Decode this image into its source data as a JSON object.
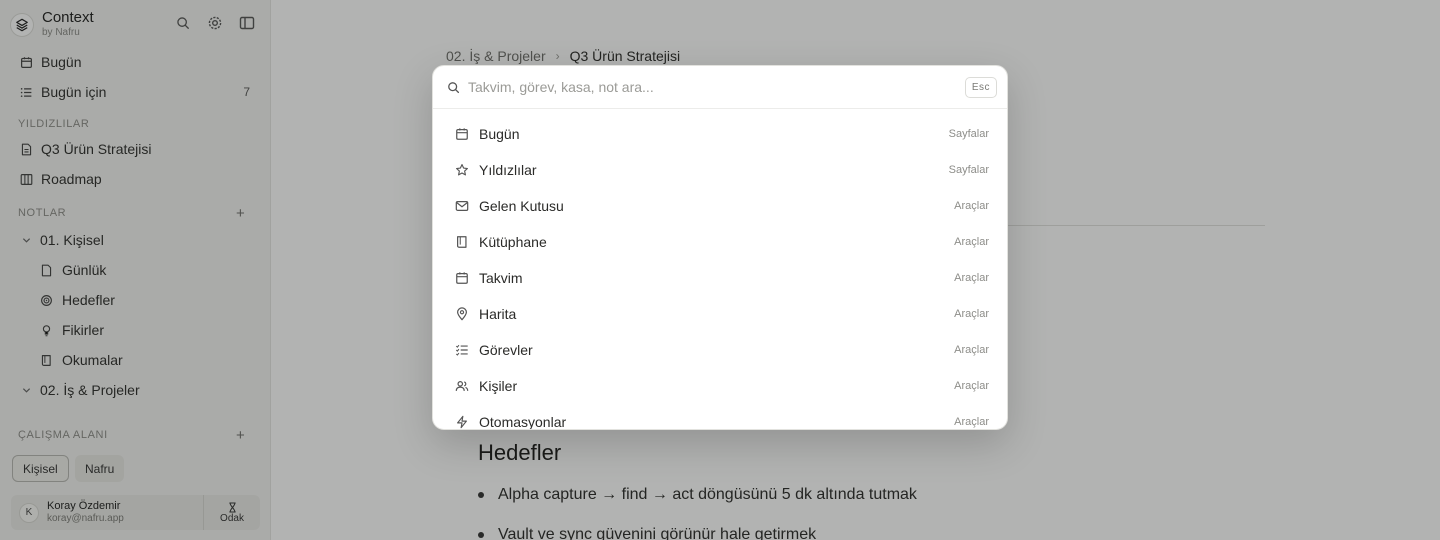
{
  "app": {
    "name": "Context",
    "byline": "by Nafru"
  },
  "sidebar": {
    "nav": [
      {
        "label": "Bugün"
      },
      {
        "label": "Bugün için",
        "count": "7"
      }
    ],
    "starred_label": "YILDIZLILAR",
    "starred": [
      {
        "label": "Q3 Ürün Stratejisi"
      },
      {
        "label": "Roadmap"
      }
    ],
    "notes_label": "NOTLAR",
    "notes": [
      {
        "label": "01. Kişisel"
      },
      {
        "label": "Günlük"
      },
      {
        "label": "Hedefler"
      },
      {
        "label": "Fikirler"
      },
      {
        "label": "Okumalar"
      },
      {
        "label": "02. İş & Projeler"
      }
    ],
    "workspace_label": "ÇALIŞMA ALANI",
    "workspaces": [
      {
        "label": "Kişisel",
        "active": true
      },
      {
        "label": "Nafru",
        "active": false
      }
    ],
    "user": {
      "initial": "K",
      "name": "Koray Özdemir",
      "email": "koray@nafru.app",
      "focus_label": "Odak"
    }
  },
  "main": {
    "breadcrumb": [
      "02. İş & Projeler",
      "Q3 Ürün Stratejisi"
    ],
    "heading": "Hedefler",
    "bullets": [
      "Alpha capture → find → act döngüsünü 5 dk altında tutmak",
      "Vault ve sync güvenini görünür hale getirmek"
    ]
  },
  "palette": {
    "placeholder": "Takvim, görev, kasa, not ara...",
    "esc_label": "Esc",
    "results": [
      {
        "label": "Bugün",
        "category": "Sayfalar",
        "icon": "calendar-icon"
      },
      {
        "label": "Yıldızlılar",
        "category": "Sayfalar",
        "icon": "star-icon"
      },
      {
        "label": "Gelen Kutusu",
        "category": "Araçlar",
        "icon": "mail-icon"
      },
      {
        "label": "Kütüphane",
        "category": "Araçlar",
        "icon": "book-icon"
      },
      {
        "label": "Takvim",
        "category": "Araçlar",
        "icon": "calendar-icon"
      },
      {
        "label": "Harita",
        "category": "Araçlar",
        "icon": "map-pin-icon"
      },
      {
        "label": "Görevler",
        "category": "Araçlar",
        "icon": "list-checks-icon"
      },
      {
        "label": "Kişiler",
        "category": "Araçlar",
        "icon": "users-icon"
      },
      {
        "label": "Otomasyonlar",
        "category": "Araçlar",
        "icon": "zap-icon"
      }
    ]
  },
  "colors": {
    "sidebar_bg": "#f4f4f2",
    "overlay": "rgba(20,24,20,0.33)",
    "palette_bg": "#ffffff"
  }
}
